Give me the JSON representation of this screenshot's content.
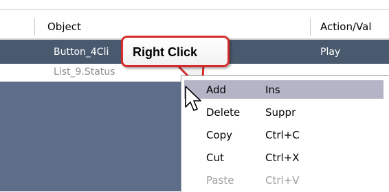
{
  "table": {
    "columns": [
      {
        "label": "Object"
      },
      {
        "label": "Action/Val"
      }
    ],
    "rows": [
      {
        "object": "Button_4Cli",
        "action": "Play",
        "selected": true
      },
      {
        "object": "List_9.Status",
        "action": "",
        "selected": false
      }
    ]
  },
  "callout": {
    "label": "Right Click",
    "border_color": "#d72b2b"
  },
  "context_menu": {
    "items": [
      {
        "label": "Add",
        "shortcut": "Ins",
        "highlighted": true,
        "enabled": true
      },
      {
        "label": "Delete",
        "shortcut": "Suppr",
        "highlighted": false,
        "enabled": true
      },
      {
        "label": "Copy",
        "shortcut": "Ctrl+C",
        "highlighted": false,
        "enabled": true
      },
      {
        "label": "Cut",
        "shortcut": "Ctrl+X",
        "highlighted": false,
        "enabled": true
      },
      {
        "label": "Paste",
        "shortcut": "Ctrl+V",
        "highlighted": false,
        "enabled": false
      }
    ]
  },
  "colors": {
    "selected_row": "#4a5a6e",
    "grid_background": "#5d6d8a",
    "menu_highlight": "#b5b4c6"
  }
}
